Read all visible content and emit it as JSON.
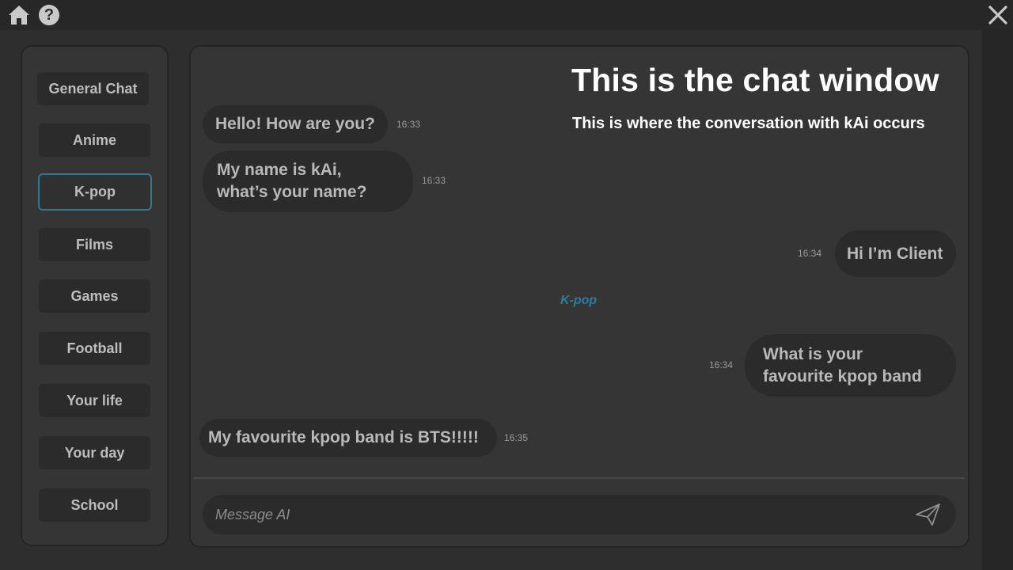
{
  "window": {
    "home_icon": "home-icon",
    "help_icon": "help-icon",
    "help_glyph": "?",
    "close_icon": "close-icon"
  },
  "sidebar": {
    "items": [
      {
        "label": "General Chat"
      },
      {
        "label": "Anime"
      },
      {
        "label": "K-pop",
        "active": true
      },
      {
        "label": "Films"
      },
      {
        "label": "Games"
      },
      {
        "label": "Football"
      },
      {
        "label": "Your life"
      },
      {
        "label": "Your day"
      },
      {
        "label": "School"
      }
    ]
  },
  "chat": {
    "title": "This is the chat window",
    "subtitle": "This is where the conversation with kAi occurs",
    "topic_marker": "K-pop",
    "messages": [
      {
        "sender": "ai",
        "lines": [
          "Hello! How are you?"
        ],
        "time": "16:33"
      },
      {
        "sender": "ai",
        "lines": [
          "My name is kAi,",
          "what’s your name?"
        ],
        "time": "16:33"
      },
      {
        "sender": "user",
        "lines": [
          "Hi I’m Client"
        ],
        "time": "16:34"
      },
      {
        "sender": "user",
        "lines": [
          "What is your",
          "favourite kpop band"
        ],
        "time": "16:34"
      },
      {
        "sender": "ai",
        "lines": [
          "My favourite kpop band is BTS!!!!!"
        ],
        "time": "16:35"
      }
    ]
  },
  "composer": {
    "placeholder": "Message AI",
    "value": "",
    "send_icon": "send-icon"
  },
  "colors": {
    "background": "#2e2e2e",
    "panel": "#353535",
    "bubble": "#2b2b2b",
    "accent": "#2c7a9a",
    "text": "#b9b9b9"
  }
}
